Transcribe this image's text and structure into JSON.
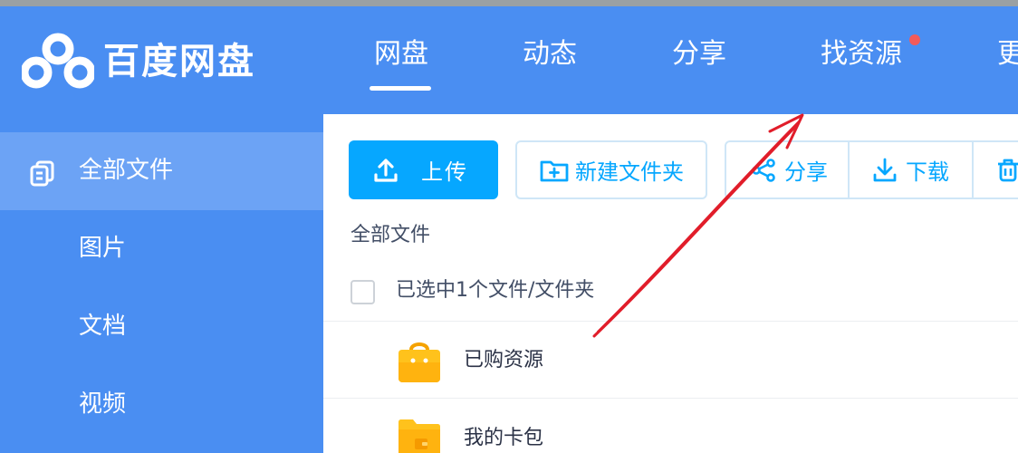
{
  "app": {
    "logo_text": "百度网盘"
  },
  "nav": {
    "items": [
      {
        "label": "网盘"
      },
      {
        "label": "动态"
      },
      {
        "label": "分享"
      },
      {
        "label": "找资源"
      },
      {
        "label": "更"
      }
    ]
  },
  "sidebar": {
    "items": [
      {
        "label": "全部文件",
        "active": true
      },
      {
        "label": "图片"
      },
      {
        "label": "文档"
      },
      {
        "label": "视频"
      }
    ]
  },
  "toolbar": {
    "upload_label": "上传",
    "new_folder_label": "新建文件夹",
    "share_label": "分享",
    "download_label": "下载"
  },
  "breadcrumb": {
    "current": "全部文件"
  },
  "selection": {
    "text": "已选中1个文件/文件夹"
  },
  "files": [
    {
      "name": "已购资源",
      "icon": "shopping-bag-folder-icon"
    },
    {
      "name": "我的卡包",
      "icon": "wallet-folder-icon"
    }
  ],
  "colors": {
    "brand_blue": "#4a8ef2",
    "accent_cyan": "#06a7ff",
    "notification_red": "#f35b5b",
    "annotation_arrow": "#e11d2a"
  }
}
